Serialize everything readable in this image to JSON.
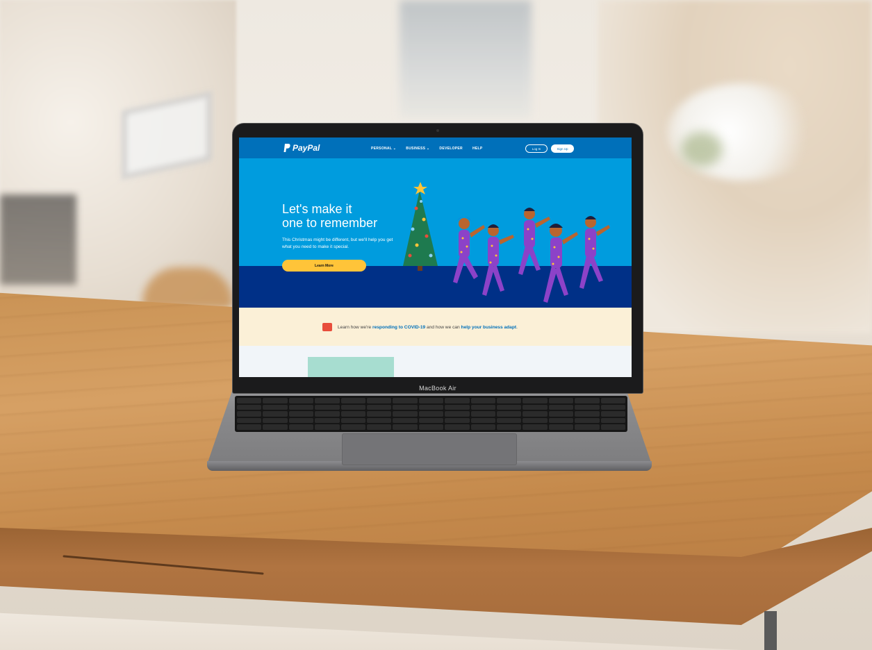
{
  "device": {
    "brand_label": "MacBook Air"
  },
  "site": {
    "logo_text": "PayPal",
    "nav": [
      {
        "label": "PERSONAL ⌄"
      },
      {
        "label": "BUSINESS ⌄"
      },
      {
        "label": "DEVELOPER"
      },
      {
        "label": "HELP"
      }
    ],
    "login_label": "Log In",
    "signup_label": "Sign Up",
    "hero": {
      "title_line1": "Let's make it",
      "title_line2": "one to remember",
      "subtitle": "This Christmas might be different, but we'll help you get what you need to make it special.",
      "cta_label": "Learn More"
    },
    "covid": {
      "prefix": "Learn how we're ",
      "link1": "responding to COVID-19",
      "middle": " and how we can ",
      "link2": "help your business adapt",
      "suffix": "."
    },
    "colors": {
      "nav_blue": "#0070ba",
      "hero_blue": "#009cde",
      "hero_dark": "#003087",
      "cta_yellow": "#ffc439",
      "covid_band": "#fbf0d7"
    }
  }
}
